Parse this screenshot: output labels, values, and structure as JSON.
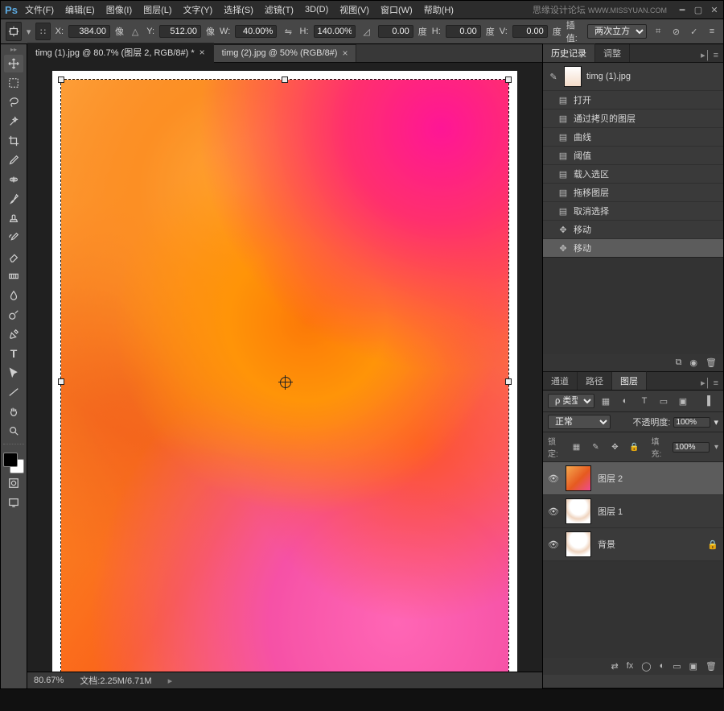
{
  "menu": {
    "items": [
      "文件(F)",
      "编辑(E)",
      "图像(I)",
      "图层(L)",
      "文字(Y)",
      "选择(S)",
      "滤镜(T)",
      "3D(D)",
      "视图(V)",
      "窗口(W)",
      "帮助(H)"
    ],
    "brand": "思缘设计论坛",
    "site": "WWW.MISSYUAN.COM"
  },
  "options": {
    "x_label": "X:",
    "x": "384.00",
    "x_unit": "像",
    "y_label": "Y:",
    "y": "512.00",
    "y_unit": "像",
    "w_label": "W:",
    "w": "40.00%",
    "h_label": "H:",
    "h": "140.00%",
    "angle_label": "",
    "angle": "0.00",
    "angle_unit": "度",
    "hskew_label": "H:",
    "hskew": "0.00",
    "vskew_label": "V:",
    "vskew": "0.00",
    "skew_unit": "度",
    "interp_label": "插值:",
    "interp": "两次立方"
  },
  "tabs": [
    {
      "label": "timg (1).jpg @ 80.7% (图层 2, RGB/8#) *",
      "active": true
    },
    {
      "label": "timg (2).jpg @ 50% (RGB/8#)",
      "active": false
    }
  ],
  "status": {
    "zoom": "80.67%",
    "doc": "文档:2.25M/6.71M"
  },
  "history": {
    "tab1": "历史记录",
    "tab2": "调整",
    "snapshot": "timg (1).jpg",
    "items": [
      {
        "icon": "doc",
        "label": "打开"
      },
      {
        "icon": "doc",
        "label": "通过拷贝的图层"
      },
      {
        "icon": "doc",
        "label": "曲线"
      },
      {
        "icon": "doc",
        "label": "阈值"
      },
      {
        "icon": "doc",
        "label": "载入选区"
      },
      {
        "icon": "doc",
        "label": "拖移图层"
      },
      {
        "icon": "doc",
        "label": "取消选择"
      },
      {
        "icon": "move",
        "label": "移动"
      },
      {
        "icon": "move",
        "label": "移动",
        "sel": true
      }
    ]
  },
  "layers_panel": {
    "tabs": [
      "通道",
      "路径",
      "图层"
    ],
    "active": "图层",
    "filter_label": "ρ 类型",
    "blend_mode": "正常",
    "opacity_label": "不透明度:",
    "opacity": "100%",
    "lock_label": "锁定:",
    "fill_label": "填充:",
    "fill": "100%",
    "layers": [
      {
        "thumb": "orange",
        "name": "图层 2",
        "sel": true,
        "visible": true
      },
      {
        "thumb": "person",
        "name": "图层 1",
        "visible": true
      },
      {
        "thumb": "person",
        "name": "背景",
        "visible": true,
        "locked": true
      }
    ]
  }
}
